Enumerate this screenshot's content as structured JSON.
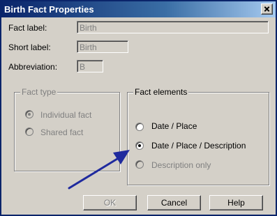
{
  "window": {
    "title": "Birth Fact Properties"
  },
  "fields": {
    "fact_label": {
      "label": "Fact label:",
      "value": "Birth"
    },
    "short_label": {
      "label": "Short label:",
      "value": "Birth"
    },
    "abbreviation": {
      "label": "Abbreviation:",
      "value": "B"
    }
  },
  "fact_type": {
    "legend": "Fact type",
    "options": [
      {
        "label": "Individual fact",
        "selected": true,
        "enabled": false
      },
      {
        "label": "Shared fact",
        "selected": false,
        "enabled": false
      }
    ]
  },
  "fact_elements": {
    "legend": "Fact elements",
    "options": [
      {
        "label": "Date / Place",
        "selected": false,
        "enabled": true
      },
      {
        "label": "Date / Place / Description",
        "selected": true,
        "enabled": true
      },
      {
        "label": "Description only",
        "selected": false,
        "enabled": false
      }
    ]
  },
  "buttons": {
    "ok": "OK",
    "cancel": "Cancel",
    "help": "Help"
  },
  "colors": {
    "annotation_arrow": "#1f2a9e",
    "title_bar": "#0a246a",
    "dialog_bg": "#d4d0c8"
  }
}
